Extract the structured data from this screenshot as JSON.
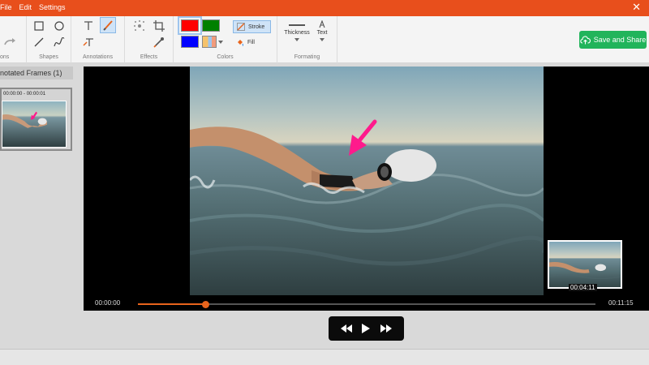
{
  "menu": {
    "file": "File",
    "edit": "Edit",
    "settings": "Settings",
    "close": "✕"
  },
  "ribbon": {
    "groups": {
      "actions": "ons",
      "shapes": "Shapes",
      "annotations": "Annotations",
      "effects": "Effects",
      "colors": "Colors",
      "formatting": "Formating"
    },
    "stroke_label": "Stroke",
    "fill_label": "Fill",
    "thickness_label": "Thickness",
    "text_label": "Text",
    "save_label": "Save and Share"
  },
  "colors": {
    "red": "#ff0000",
    "green": "#008000",
    "blue": "#0000ff",
    "accent": "#e84f1c",
    "save": "#21b45b"
  },
  "left_panel": {
    "header": "notated Frames (1)",
    "frame_times": "00:00:00 - 00:00:01"
  },
  "video": {
    "thumbnail_time": "00:04:11"
  },
  "timeline": {
    "current_time": "00:00:00",
    "total_time": "00:11:15",
    "progress": 0.147
  },
  "icons": [
    "redo-icon",
    "rectangle-icon",
    "ellipse-icon",
    "line-icon",
    "freehand-icon",
    "text-tool-icon",
    "brush-icon",
    "text-style-icon",
    "blur-icon",
    "crop-icon",
    "eyedropper-icon",
    "cloud-upload-icon",
    "rewind-icon",
    "play-icon",
    "fast-forward-icon"
  ]
}
